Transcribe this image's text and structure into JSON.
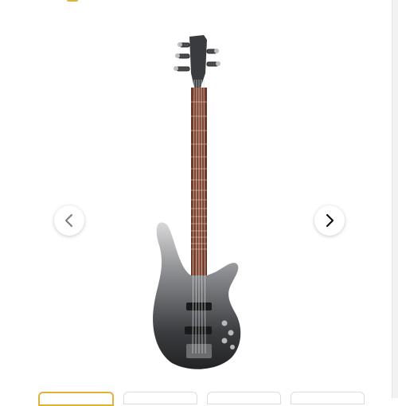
{
  "gallery": {
    "image": {
      "icon": "bass-guitar-image",
      "body_color": "#2f3033",
      "fingerboard_color": "#7a3e2b"
    },
    "prev_icon": "chevron-left-icon",
    "next_icon": "chevron-right-icon",
    "thumbnails": [
      {
        "state": "active"
      },
      {
        "state": "inactive"
      },
      {
        "state": "inactive"
      },
      {
        "state": "inactive"
      }
    ],
    "accent_color": "#e2b13c"
  }
}
